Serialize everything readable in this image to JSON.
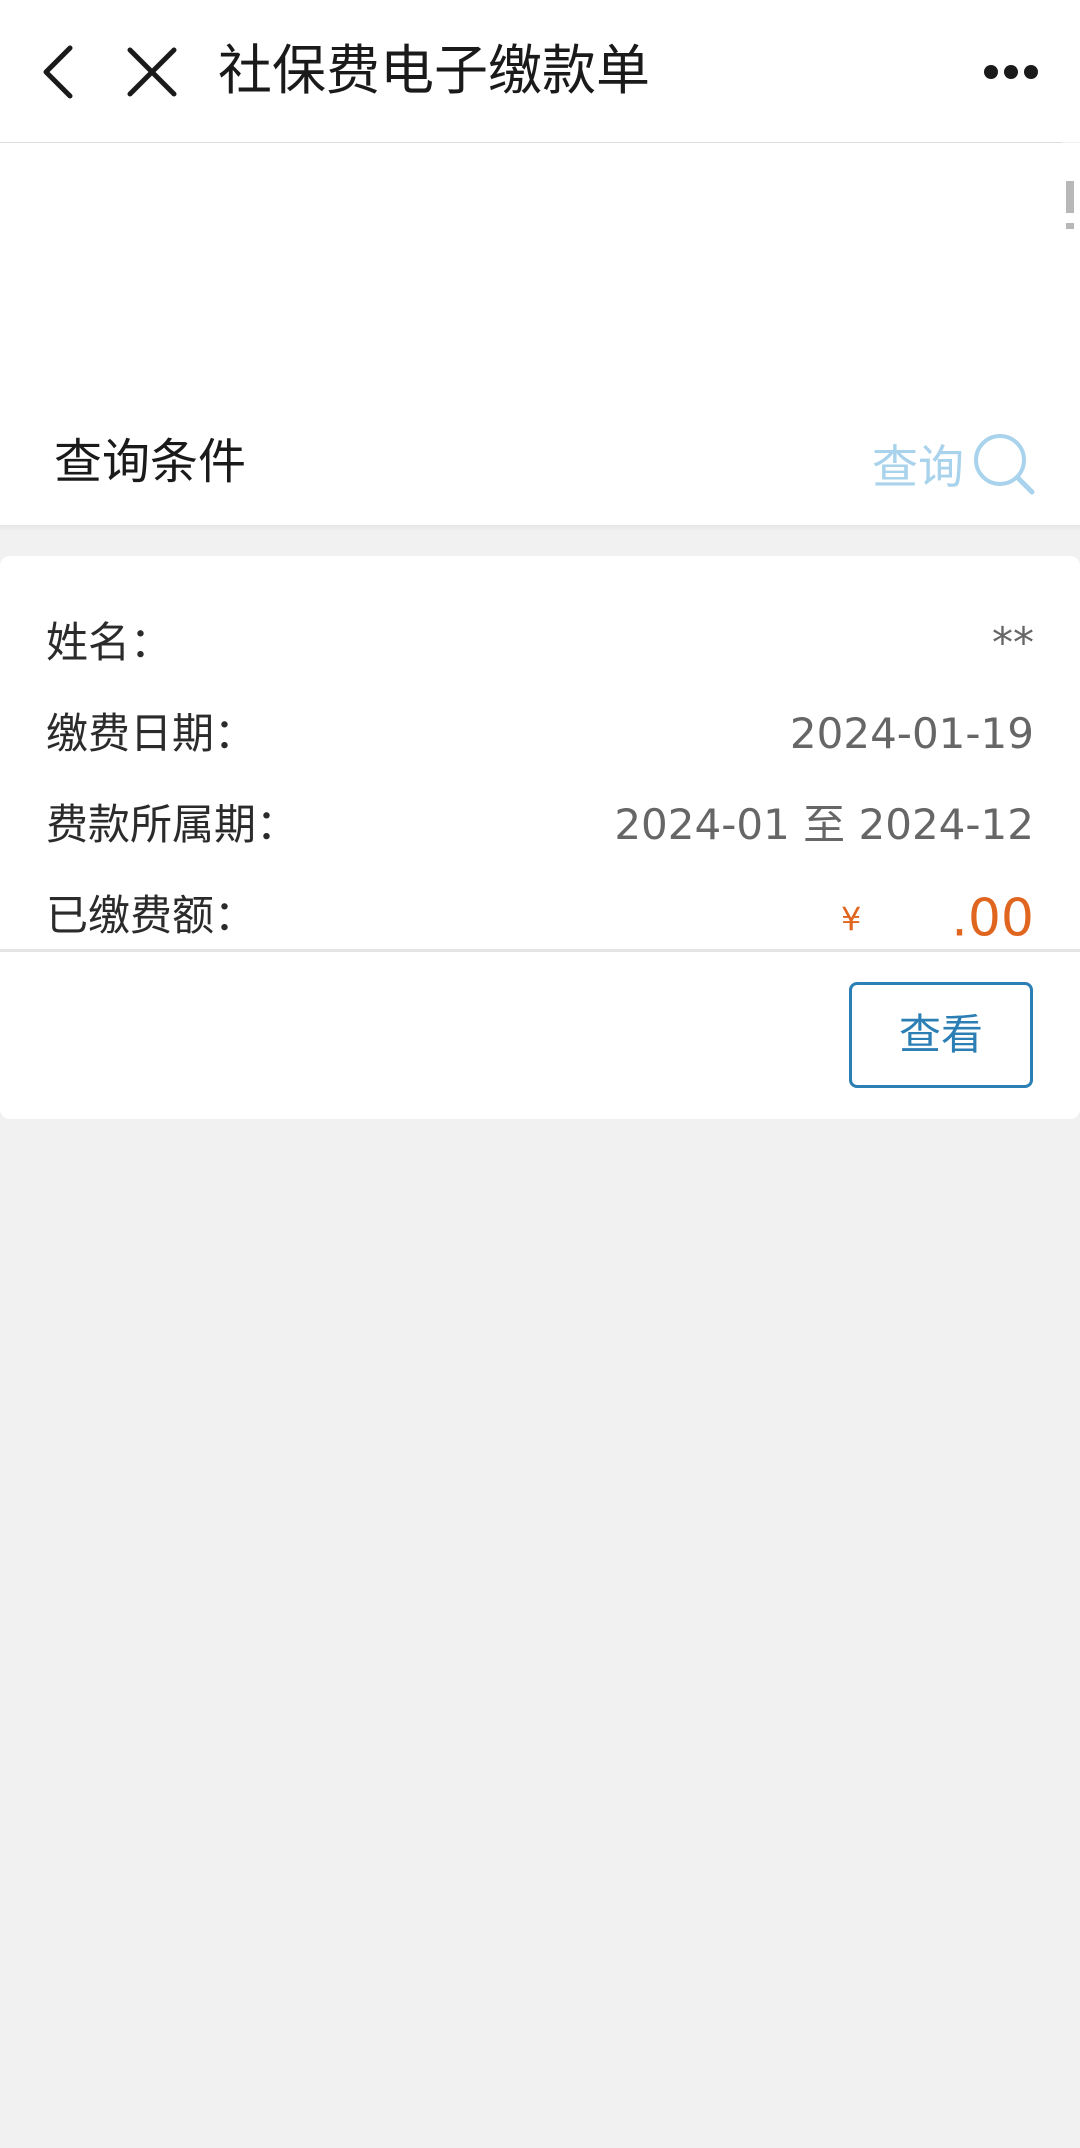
{
  "navbar": {
    "title": "社保费电子缴款单",
    "back_icon": "chevron-left-icon",
    "close_icon": "close-icon",
    "more_icon": "more-dots-icon"
  },
  "query": {
    "label": "查询条件",
    "action_text": "查询",
    "action_icon": "search-icon",
    "action_color": "#a9d3ec"
  },
  "record": {
    "rows": [
      {
        "label": "姓名：",
        "value": "**"
      },
      {
        "label": "缴费日期：",
        "value": "2024-01-19"
      },
      {
        "label": "费款所属期：",
        "value": "2024-01 至 2024-12"
      },
      {
        "label": "已缴费额：",
        "currency": "¥",
        "value": ".00"
      }
    ],
    "amount_color": "#e0651f",
    "view_button": "查看",
    "button_color": "#2c7fb4"
  }
}
